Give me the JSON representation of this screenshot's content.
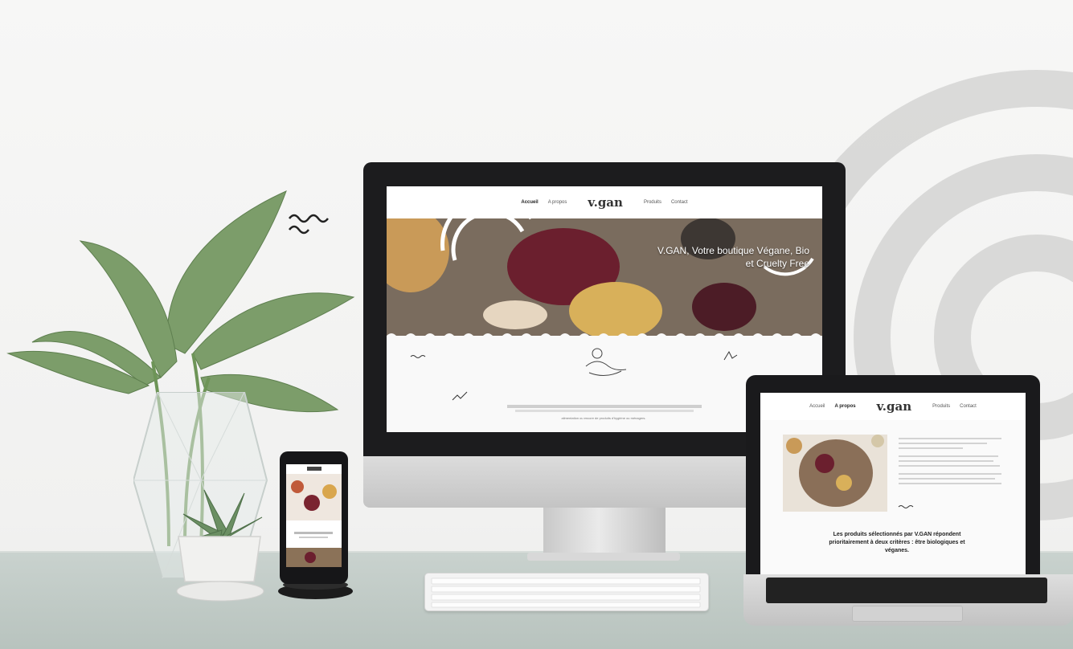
{
  "desktop_site": {
    "nav": {
      "left": [
        "Accueil",
        "A propos"
      ],
      "logo": "v.gan",
      "right": [
        "Produits",
        "Contact"
      ]
    },
    "hero_title": "V.GAN, Votre boutique Végane, Bio et Cruelty Free",
    "body_text_line3": "alimentation ou encore de produits d'hygiène ou ménagers."
  },
  "laptop_site": {
    "nav": {
      "left": [
        "Accueil",
        "A propos"
      ],
      "logo": "v.gan",
      "right": [
        "Produits",
        "Contact"
      ]
    },
    "highlight": "Les produits sélectionnés par V.GAN répondent prioritairement à deux critères : être biologiques et véganes."
  },
  "colors": {
    "bezel": "#1c1c1e",
    "desk": "#c4cdc9",
    "hero": "#6f6357"
  }
}
